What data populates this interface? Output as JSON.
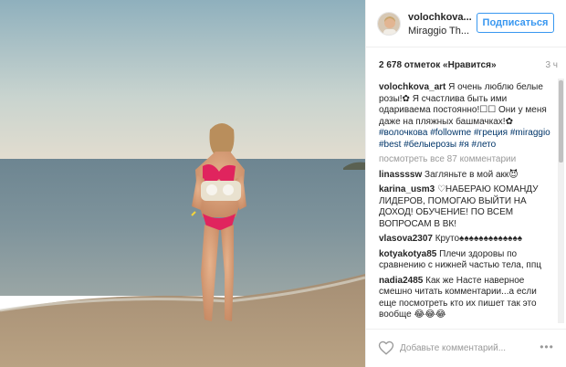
{
  "post": {
    "username": "volochkova_art",
    "username_display": "volochkova...",
    "location": "Miraggio Th...",
    "follow_label": "Подписаться",
    "likes": "2 678 отметок «Нравится»",
    "time": "3 ч",
    "view_all": "посмотреть все 87 комментарии",
    "add_comment_placeholder": "Добавьте комментарий...",
    "more_icon": "ellipsis-icon",
    "heart_icon": "heart-icon"
  },
  "caption": {
    "user": "volochkova_art",
    "text": "Я очень люблю белые розы!✿ Я счастлива быть ими одариваема постоянно!☐☐ Они у меня даже на пляжных башмачках!✿",
    "tags": "#волочкова #followme #греция #miraggio #best #белыерозы #я #лето"
  },
  "comments": [
    {
      "user": "linassssw",
      "text": "Загляньте в мой акк😈"
    },
    {
      "user": "karina_usm3",
      "text": "♡НАБЕРАЮ КОМАНДУ ЛИДЕРОВ, ПОМОГАЮ ВЫЙТИ НА ДОХОД! ОБУЧЕНИЕ! ПО ВСЕМ ВОПРОСАМ В ВК!"
    },
    {
      "user": "vlasova2307",
      "text": "Круто♠♠♠♠♠♠♠♠♠♠♠♠♠"
    },
    {
      "user": "kotyakotya85",
      "text": "Плечи здоровы по сравнению с нижней частью тела, ппц"
    },
    {
      "user": "nadia2485",
      "text": "Как же Насте наверное смешно читать комментарии...а если еще посмотреть кто их пишет так это вообще 😂😂😂"
    }
  ],
  "colors": {
    "accent": "#3897f0",
    "text": "#262626",
    "muted": "#999999",
    "hashtag": "#003569"
  }
}
